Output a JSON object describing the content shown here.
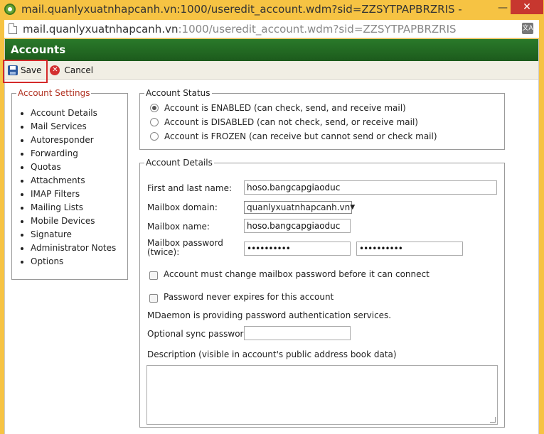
{
  "window": {
    "title": "mail.quanlyxuatnhapcanh.vn:1000/useredit_account.wdm?sid=ZZSYTPAPBRZRIS - Google Chr...",
    "minimize_glyph": "—",
    "close_glyph": "✕"
  },
  "address": {
    "host": "mail.quanlyxuatnhapcanh.vn",
    "rest": ":1000/useredit_account.wdm?sid=ZZSYTPAPBRZRIS",
    "translate_glyph": "文A"
  },
  "app": {
    "header_title": "Accounts"
  },
  "toolbar": {
    "save_label": "Save",
    "cancel_label": "Cancel",
    "cancel_glyph": "✕"
  },
  "sidebar": {
    "legend": "Account Settings",
    "items": [
      "Account Details",
      "Mail Services",
      "Autoresponder",
      "Forwarding",
      "Quotas",
      "Attachments",
      "IMAP Filters",
      "Mailing Lists",
      "Mobile Devices",
      "Signature",
      "Administrator Notes",
      "Options"
    ]
  },
  "status": {
    "legend": "Account Status",
    "options": [
      {
        "label": "Account is ENABLED (can check, send, and receive mail)",
        "checked": true
      },
      {
        "label": "Account is DISABLED (can not check, send, or receive mail)",
        "checked": false
      },
      {
        "label": "Account is FROZEN (can receive but cannot send or check mail)",
        "checked": false
      }
    ]
  },
  "details": {
    "legend": "Account Details",
    "name_label": "First and last name:",
    "name_value": "hoso.bangcapgiaoduc",
    "domain_label": "Mailbox domain:",
    "domain_value": "quanlyxuatnhapcanh.vn",
    "mailbox_label": "Mailbox name:",
    "mailbox_value": "hoso.bangcapgiaoduc",
    "password_label_1": "Mailbox password",
    "password_label_2": "(twice):",
    "password_mask": "••••••••••",
    "must_change_label": "Account must change mailbox password before it can connect",
    "never_expires_label": "Password never expires for this account",
    "auth_note": "MDaemon is providing password authentication services.",
    "sync_label": "Optional sync password:",
    "sync_value": "",
    "description_label": "Description (visible in account's public address book data)"
  }
}
